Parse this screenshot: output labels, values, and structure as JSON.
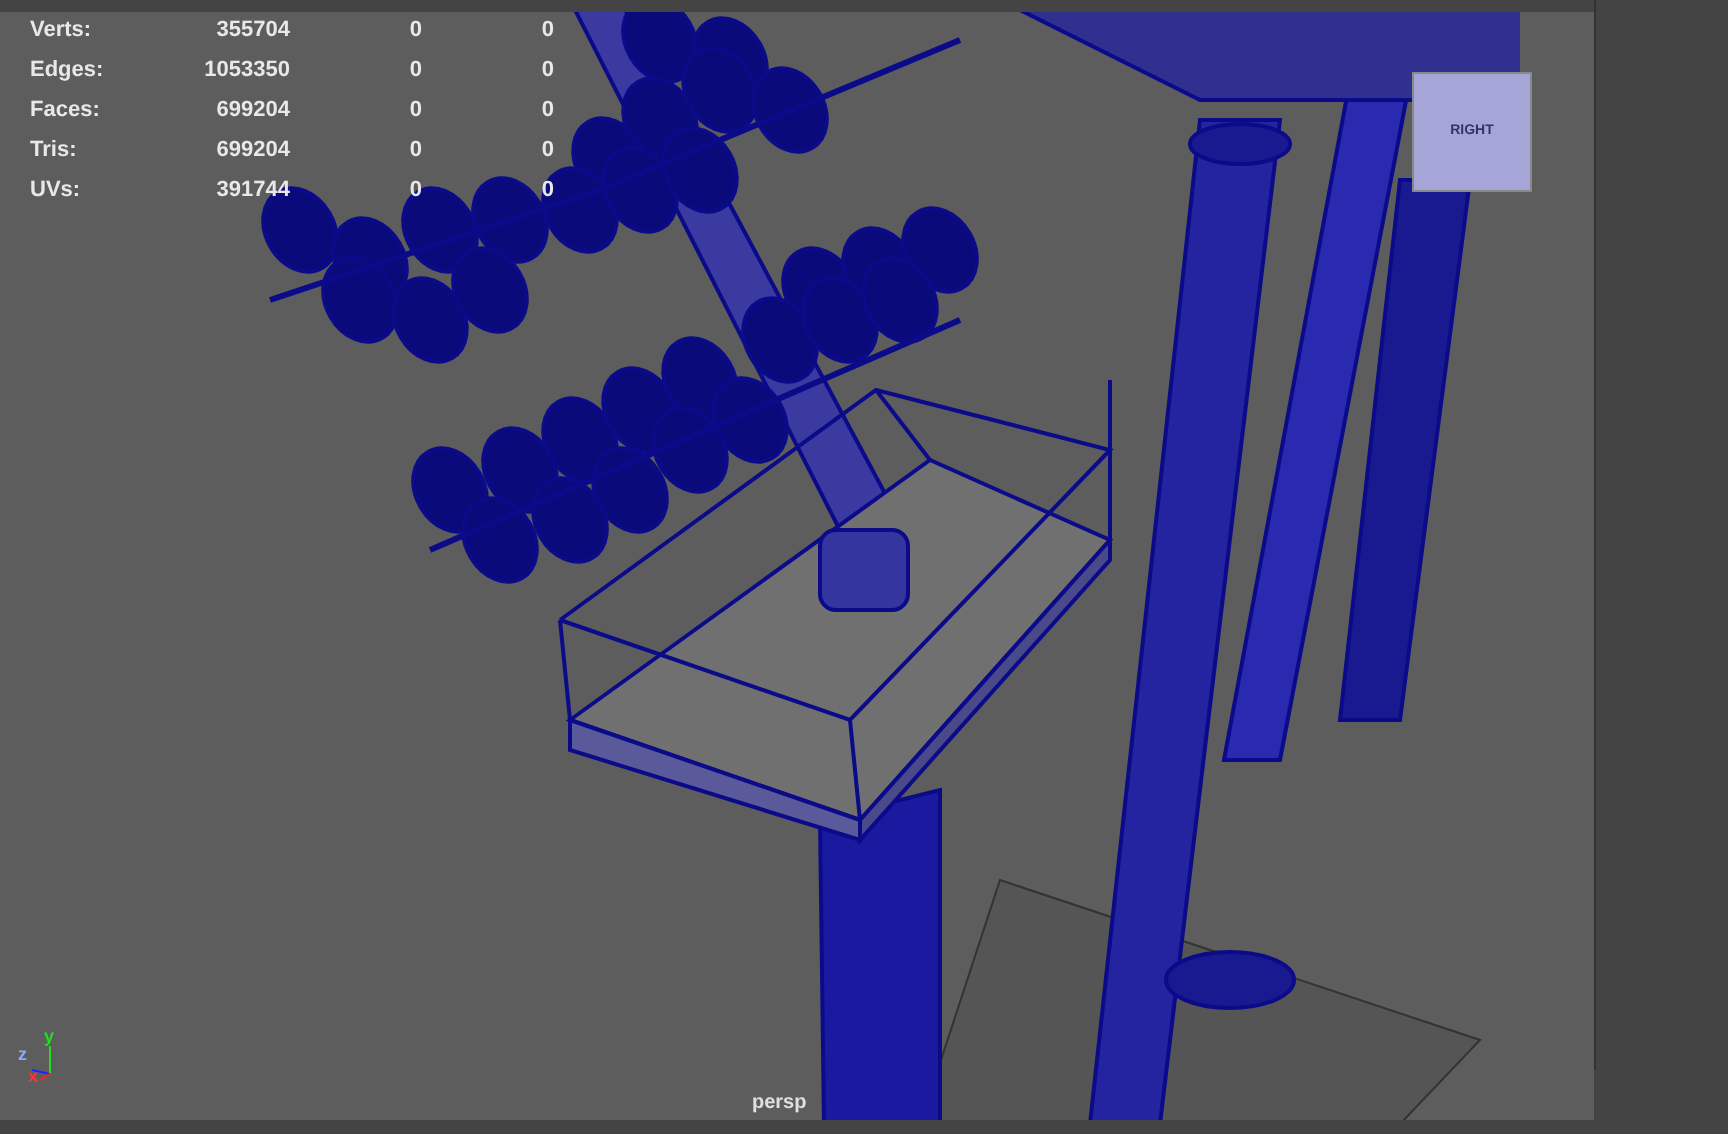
{
  "heads_up_display": {
    "rows": [
      {
        "label": "Verts:",
        "values": [
          "355704",
          "0",
          "0"
        ]
      },
      {
        "label": "Edges:",
        "values": [
          "1053350",
          "0",
          "0"
        ]
      },
      {
        "label": "Faces:",
        "values": [
          "699204",
          "0",
          "0"
        ]
      },
      {
        "label": "Tris:",
        "values": [
          "699204",
          "0",
          "0"
        ]
      },
      {
        "label": "UVs:",
        "values": [
          "391744",
          "0",
          "0"
        ]
      }
    ]
  },
  "view_cube": {
    "face": "RIGHT"
  },
  "axis_gizmo": {
    "x": "x",
    "y": "y",
    "z": "z"
  },
  "camera_label": "persp"
}
